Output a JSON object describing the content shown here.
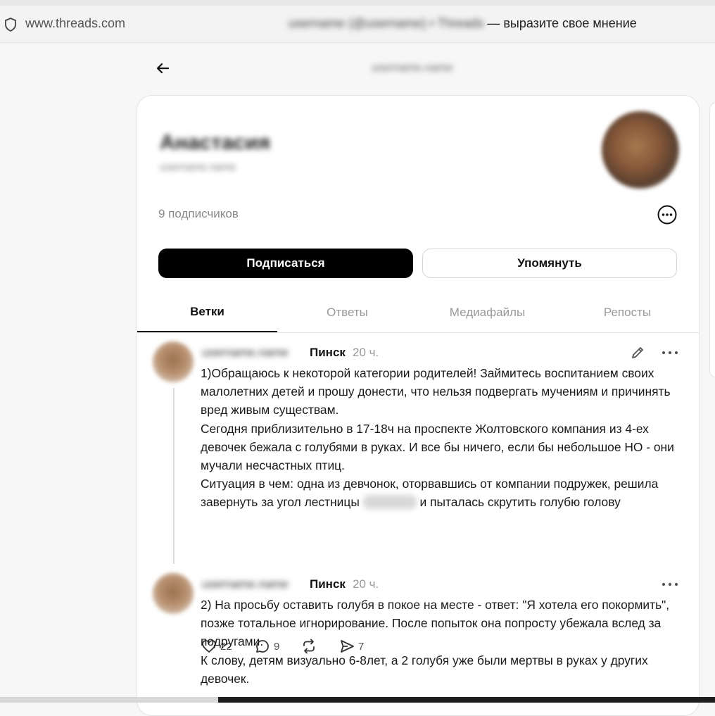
{
  "browser": {
    "url": "www.threads.com",
    "tab_title_blurred": "username (@username) • Threads",
    "tab_title_suffix": " — выразите свое мнение"
  },
  "header": {
    "handle": "username.name"
  },
  "profile": {
    "display_name": "Анастасия",
    "username": "username.name",
    "followers": "9 подписчиков",
    "follow_button": "Подписаться",
    "mention_button": "Упомянуть"
  },
  "tabs": [
    {
      "label": "Ветки",
      "active": true
    },
    {
      "label": "Ответы",
      "active": false
    },
    {
      "label": "Медиафайлы",
      "active": false
    },
    {
      "label": "Репосты",
      "active": false
    }
  ],
  "posts": [
    {
      "username": "username.name",
      "city": "Пинск",
      "time": "20 ч.",
      "paragraphs": [
        "1)Обращаюсь к некоторой категории родителей! Займитесь воспитанием своих малолетних детей и прошу донести, что нельзя подвергать мучениям и причинять вред живым существам.",
        "Сегодня приблизительно в 17-18ч на проспекте Жолтовского компания из 4-ех девочек бежала с голубями в руках. И все бы ничего, если бы небольшое НО - они мучали несчастных птиц."
      ],
      "para3_before": "Ситуация в чем: одна из девчонок, оторвавшись от компании подружек, решила завернуть за угол лестницы ",
      "para3_after": " и пыталась скрутить голубю голову",
      "likes": "22",
      "replies": "9",
      "shares": "7"
    },
    {
      "username": "username.name",
      "city": "Пинск",
      "time": "20 ч.",
      "paragraphs": [
        "2) На просьбу оставить голубя в покое на месте - ответ: \"Я хотела его покормить\", позже тотальное игнорирование. После попыток она попросту убежала вслед за подругами.",
        "К слову, детям визуально 6-8лет, а 2 голубя уже были мертвы в руках у других девочек."
      ]
    }
  ],
  "colors": {
    "accent": "#000000",
    "muted_text": "#999999",
    "border": "#e3e3e3"
  }
}
